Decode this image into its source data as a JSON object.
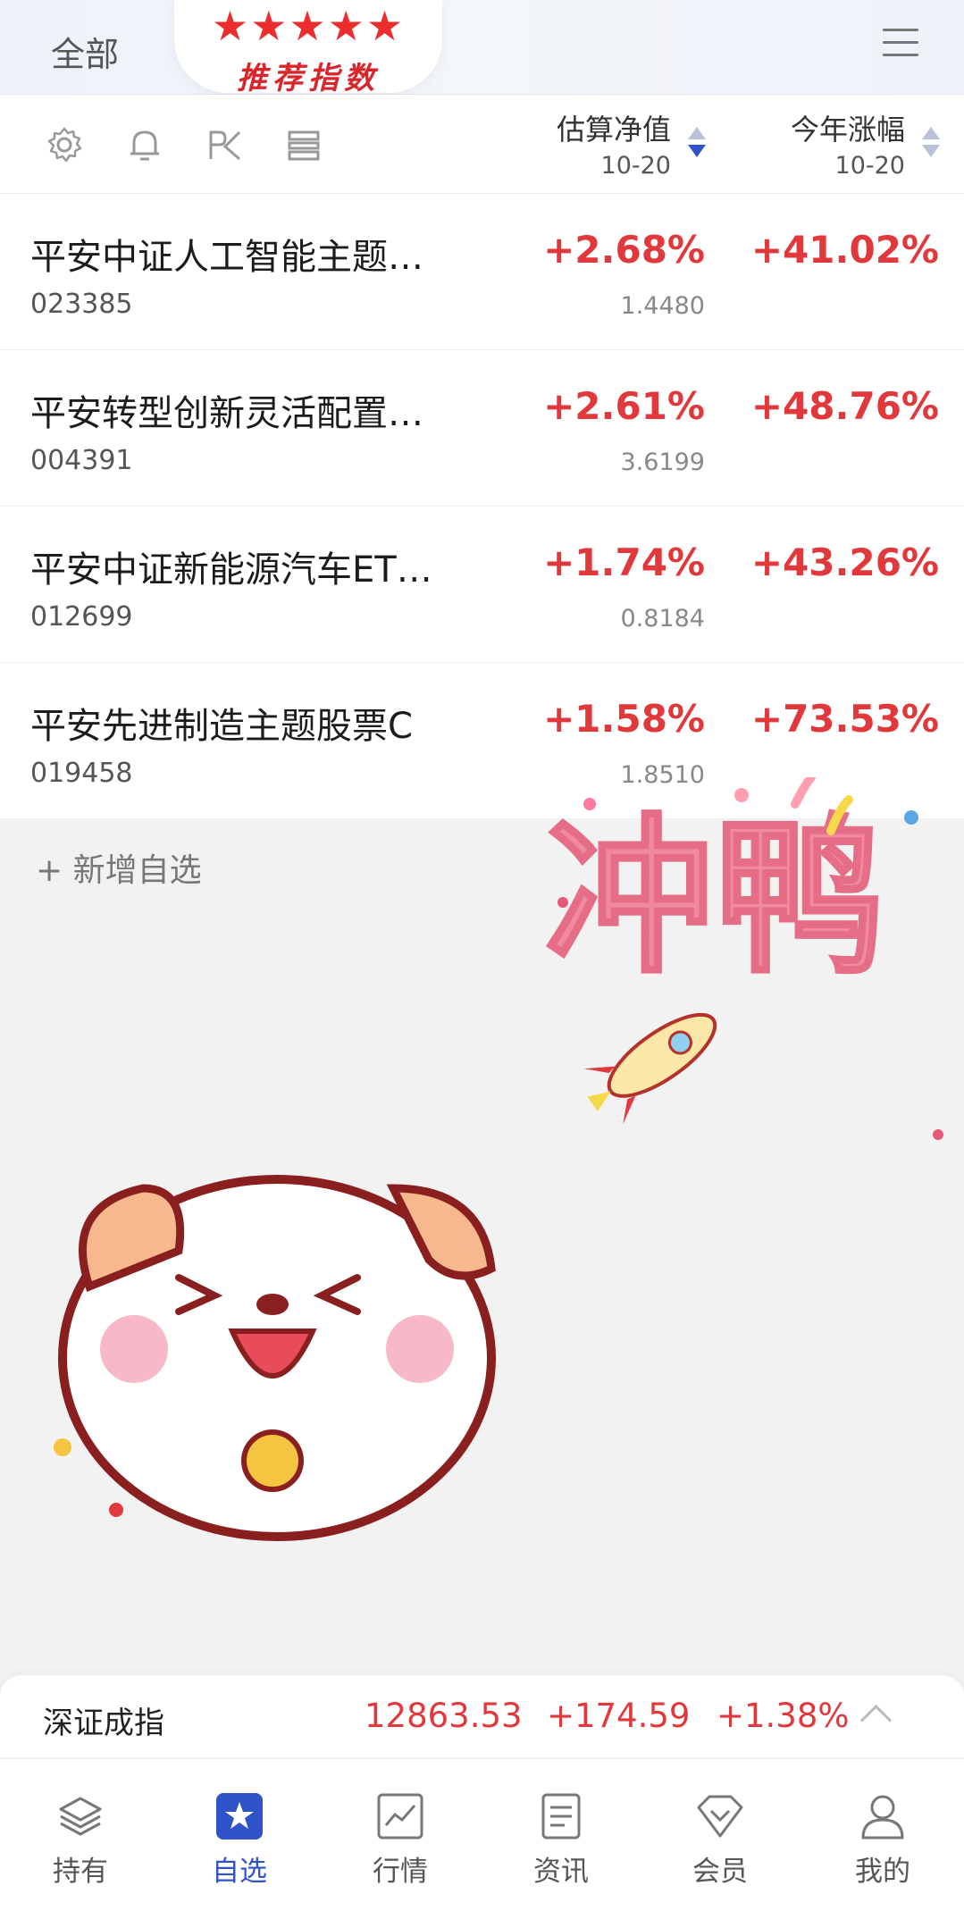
{
  "header": {
    "scope_label": "全部",
    "badge_stars": "★★★★★",
    "badge_text": "推荐指数"
  },
  "toolbar": {
    "col_est": {
      "title": "估算净值",
      "date": "10-20"
    },
    "col_ytd": {
      "title": "今年涨幅",
      "date": "10-20"
    }
  },
  "funds": [
    {
      "name": "平安中证人工智能主题…",
      "code": "023385",
      "est_pct": "+2.68%",
      "nav": "1.4480",
      "ytd_pct": "+41.02%"
    },
    {
      "name": "平安转型创新灵活配置…",
      "code": "004391",
      "est_pct": "+2.61%",
      "nav": "3.6199",
      "ytd_pct": "+48.76%"
    },
    {
      "name": "平安中证新能源汽车ET…",
      "code": "012699",
      "est_pct": "+1.74%",
      "nav": "0.8184",
      "ytd_pct": "+43.26%"
    },
    {
      "name": "平安先进制造主题股票C",
      "code": "019458",
      "est_pct": "+1.58%",
      "nav": "1.8510",
      "ytd_pct": "+73.53%"
    }
  ],
  "add_watch": "+ 新增自选",
  "sticker_text": "冲鸭",
  "index_bar": {
    "name": "深证成指",
    "value": "12863.53",
    "change": "+174.59",
    "pct": "+1.38%"
  },
  "tabs": [
    {
      "label": "持有",
      "icon": "layers-icon"
    },
    {
      "label": "自选",
      "icon": "star-icon"
    },
    {
      "label": "行情",
      "icon": "chart-icon"
    },
    {
      "label": "资讯",
      "icon": "news-icon"
    },
    {
      "label": "会员",
      "icon": "diamond-icon"
    },
    {
      "label": "我的",
      "icon": "user-icon"
    }
  ],
  "colors": {
    "rise": "#e1383c",
    "accent": "#2f53c8"
  }
}
